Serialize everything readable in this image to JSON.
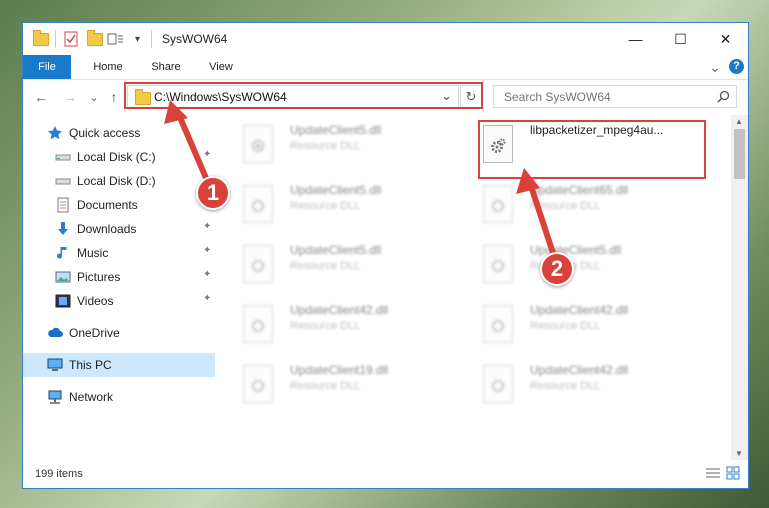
{
  "window": {
    "title": "SysWOW64",
    "minimize_glyph": "—",
    "maximize_glyph": "☐",
    "close_glyph": "✕"
  },
  "ribbon": {
    "tabs": [
      "File",
      "Home",
      "Share",
      "View"
    ],
    "expand_glyph": "⌄",
    "help_glyph": "?"
  },
  "nav": {
    "back_glyph": "←",
    "forward_glyph": "→",
    "recent_glyph": "⌄",
    "up_glyph": "↑",
    "address": "C:\\Windows\\SysWOW64",
    "address_dropdown_glyph": "⌄",
    "refresh_glyph": "↻",
    "search_placeholder": "Search SysWOW64"
  },
  "sidebar": {
    "items": [
      {
        "label": "Quick access",
        "icon": "star-icon",
        "pinned": false
      },
      {
        "label": "Local Disk (C:)",
        "icon": "drive-icon",
        "pinned": true
      },
      {
        "label": "Local Disk (D:)",
        "icon": "drive-icon",
        "pinned": true
      },
      {
        "label": "Documents",
        "icon": "documents-icon",
        "pinned": true
      },
      {
        "label": "Downloads",
        "icon": "downloads-icon",
        "pinned": true
      },
      {
        "label": "Music",
        "icon": "music-icon",
        "pinned": true
      },
      {
        "label": "Pictures",
        "icon": "pictures-icon",
        "pinned": true
      },
      {
        "label": "Videos",
        "icon": "videos-icon",
        "pinned": true
      },
      {
        "label": "OneDrive",
        "icon": "onedrive-icon",
        "pinned": false
      },
      {
        "label": "This PC",
        "icon": "pc-icon",
        "pinned": false,
        "selected": true
      },
      {
        "label": "Network",
        "icon": "network-icon",
        "pinned": false
      }
    ],
    "pin_glyph": "📌"
  },
  "files": [
    {
      "name": "UpdateClient5.dll",
      "type": "Resource DLL"
    },
    {
      "name": "libpacketizer_mpeg4au...",
      "type": ""
    },
    {
      "name": "UpdateClient5.dll",
      "type": "Resource DLL"
    },
    {
      "name": "UpdateClient65.dll",
      "type": "Resource DLL"
    },
    {
      "name": "UpdateClient5.dll",
      "type": "Resource DLL"
    },
    {
      "name": "UpdateClient5.dll",
      "type": "Resource DLL"
    },
    {
      "name": "UpdateClient42.dll",
      "type": "Resource DLL"
    },
    {
      "name": "UpdateClient42.dll",
      "type": "Resource DLL"
    },
    {
      "name": "UpdateClient19.dll",
      "type": "Resource DLL"
    },
    {
      "name": "UpdateClient42.dll",
      "type": "Resource DLL"
    }
  ],
  "status": {
    "item_count": "199 items"
  },
  "annotations": {
    "step1": "1",
    "step2": "2",
    "color": "#d9413a"
  },
  "colors": {
    "accent": "#1979ca",
    "selection": "#cce8ff"
  }
}
